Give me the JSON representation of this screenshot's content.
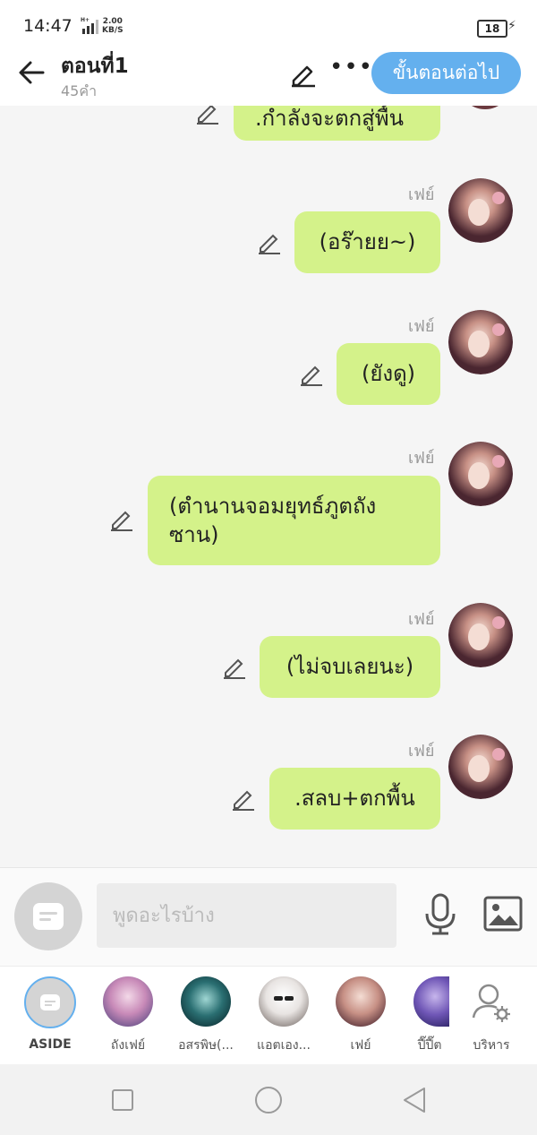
{
  "status_bar": {
    "time": "14:47",
    "network": "H+",
    "speed_value": "2.00",
    "speed_unit": "KB/S",
    "battery": "18"
  },
  "header": {
    "title": "ตอนที่1",
    "word_count": "45คำ",
    "next_label": "ขั้นตอนต่อไป"
  },
  "messages": [
    {
      "sender": "",
      "text": ".กำลังจะตกสู่พื้น"
    },
    {
      "sender": "เฟย์",
      "text": "(อร๊ายย~)"
    },
    {
      "sender": "เฟย์",
      "text": "(ยังดู)"
    },
    {
      "sender": "เฟย์",
      "text_line1": "(ตำนานจอมยุทธ์ภูตถัง",
      "text_line2": "ซาน)"
    },
    {
      "sender": "เฟย์",
      "text": "(ไม่จบเลยนะ)"
    },
    {
      "sender": "เฟย์",
      "text": ".สลบ+ตกพื้น"
    }
  ],
  "input": {
    "placeholder": "พูดอะไรบ้าง"
  },
  "characters": [
    {
      "label": "ASIDE"
    },
    {
      "label": "ถังเฟย์"
    },
    {
      "label": "อสรพิษ(..."
    },
    {
      "label": "แอตเอง..."
    },
    {
      "label": "เฟย์"
    },
    {
      "label": "ปี๊ปี๊ต"
    },
    {
      "label": "บริหาร"
    }
  ],
  "colors": {
    "bubble": "#d4f28a",
    "accent": "#64b0ee",
    "background": "#f5f5f5"
  }
}
